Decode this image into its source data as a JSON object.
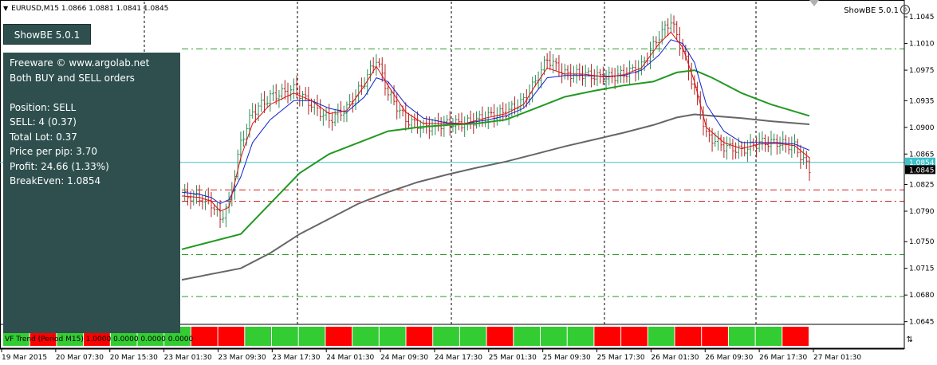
{
  "symbol_title": "EURUSD,M15  1.0866 1.0881 1.0841 1.0845",
  "indicator_name": "ShowBE 5.0.1",
  "button_label": "ShowBE 5.0.1",
  "info_panel": {
    "lines": [
      "Freeware © www.argolab.net",
      "Both BUY and SELL orders",
      "",
      "Position: SELL",
      "SELL: 4 (0.37)",
      "Total Lot: 0.37",
      "Price per pip: 3.70",
      "Profit: 24.66 (1.33%)",
      "BreakEven: 1.0854"
    ]
  },
  "subwindow_label": "VF Trend (Period M15) 1.0000 0.0000 0.0000 0.0000",
  "price_axis_labels": [
    "1.1045",
    "1.1010",
    "1.0975",
    "1.0935",
    "1.0900",
    "1.0865",
    "1.0825",
    "1.0790",
    "1.0750",
    "1.0715",
    "1.0680",
    "1.0645"
  ],
  "breakeven_price_label": "1.0854",
  "current_price_label": "1.0845",
  "time_axis_labels": [
    "19 Mar 2015",
    "20 Mar 07:30",
    "20 Mar 15:30",
    "23 Mar 01:30",
    "23 Mar 09:30",
    "23 Mar 17:30",
    "24 Mar 01:30",
    "24 Mar 09:30",
    "24 Mar 17:30",
    "25 Mar 01:30",
    "25 Mar 09:30",
    "25 Mar 17:30",
    "26 Mar 01:30",
    "26 Mar 09:30",
    "26 Mar 17:30",
    "27 Mar 01:30"
  ],
  "colors": {
    "bullish_bar": "#2e8b57",
    "bearish_bar": "#b22222",
    "fast_ma": "#e01010",
    "mid_ma": "#1020d0",
    "slow_ma": "#229922",
    "long_ma": "#666666",
    "breakeven_line": "#40c0c8",
    "level_green": "#2a9a2a",
    "level_red": "#d02020",
    "panel_bg": "#2f4f4f"
  },
  "chart_data": {
    "type": "candlestick",
    "ylim": [
      1.063,
      1.1065
    ],
    "breakeven": 1.0854,
    "last_price": 1.0845,
    "horizontal_levels_green": [
      1.1003,
      1.0733,
      1.0678
    ],
    "horizontal_levels_red": [
      1.0803,
      1.0818
    ],
    "close_path": [
      [
        0,
        1.081
      ],
      [
        6,
        1.0808
      ],
      [
        10,
        1.08
      ],
      [
        13,
        1.078
      ],
      [
        16,
        1.08
      ],
      [
        20,
        1.088
      ],
      [
        24,
        1.092
      ],
      [
        30,
        1.094
      ],
      [
        38,
        1.095
      ],
      [
        44,
        1.093
      ],
      [
        50,
        1.091
      ],
      [
        56,
        1.0925
      ],
      [
        62,
        1.096
      ],
      [
        66,
        1.099
      ],
      [
        70,
        1.0945
      ],
      [
        76,
        1.091
      ],
      [
        82,
        1.09
      ],
      [
        90,
        1.0905
      ],
      [
        96,
        1.0905
      ],
      [
        104,
        1.0915
      ],
      [
        110,
        1.092
      ],
      [
        116,
        1.0935
      ],
      [
        120,
        1.096
      ],
      [
        124,
        1.099
      ],
      [
        130,
        1.097
      ],
      [
        136,
        1.097
      ],
      [
        144,
        1.0965
      ],
      [
        150,
        1.097
      ],
      [
        156,
        1.098
      ],
      [
        162,
        1.102
      ],
      [
        166,
        1.104
      ],
      [
        170,
        1.1
      ],
      [
        174,
        1.095
      ],
      [
        178,
        1.089
      ],
      [
        184,
        1.0875
      ],
      [
        190,
        1.087
      ],
      [
        196,
        1.088
      ],
      [
        202,
        1.088
      ],
      [
        208,
        1.0875
      ],
      [
        213,
        1.0845
      ]
    ],
    "ma_fast": [
      [
        0,
        1.081
      ],
      [
        6,
        1.0808
      ],
      [
        10,
        1.0803
      ],
      [
        13,
        1.079
      ],
      [
        16,
        1.0795
      ],
      [
        20,
        1.086
      ],
      [
        24,
        1.0905
      ],
      [
        30,
        1.093
      ],
      [
        38,
        1.0945
      ],
      [
        44,
        1.0935
      ],
      [
        50,
        1.0918
      ],
      [
        56,
        1.0922
      ],
      [
        62,
        1.0955
      ],
      [
        66,
        1.098
      ],
      [
        70,
        1.0955
      ],
      [
        76,
        1.092
      ],
      [
        82,
        1.0905
      ],
      [
        90,
        1.0905
      ],
      [
        96,
        1.0905
      ],
      [
        104,
        1.0913
      ],
      [
        110,
        1.0918
      ],
      [
        116,
        1.093
      ],
      [
        120,
        1.0955
      ],
      [
        124,
        1.0978
      ],
      [
        130,
        1.097
      ],
      [
        136,
        1.097
      ],
      [
        144,
        1.0966
      ],
      [
        150,
        1.0969
      ],
      [
        156,
        1.0978
      ],
      [
        162,
        1.101
      ],
      [
        166,
        1.1025
      ],
      [
        170,
        1.1005
      ],
      [
        174,
        1.096
      ],
      [
        178,
        1.09
      ],
      [
        184,
        1.088
      ],
      [
        190,
        1.0872
      ],
      [
        196,
        1.0878
      ],
      [
        202,
        1.0879
      ],
      [
        208,
        1.0876
      ],
      [
        213,
        1.086
      ]
    ],
    "ma_mid": [
      [
        0,
        1.0815
      ],
      [
        6,
        1.0812
      ],
      [
        10,
        1.0808
      ],
      [
        13,
        1.08
      ],
      [
        16,
        1.0805
      ],
      [
        20,
        1.0835
      ],
      [
        24,
        1.088
      ],
      [
        30,
        1.091
      ],
      [
        38,
        1.0935
      ],
      [
        44,
        1.0935
      ],
      [
        50,
        1.0925
      ],
      [
        56,
        1.092
      ],
      [
        62,
        1.094
      ],
      [
        66,
        1.0965
      ],
      [
        70,
        1.096
      ],
      [
        76,
        1.093
      ],
      [
        82,
        1.0912
      ],
      [
        90,
        1.0906
      ],
      [
        96,
        1.0905
      ],
      [
        104,
        1.091
      ],
      [
        110,
        1.0915
      ],
      [
        116,
        1.0925
      ],
      [
        120,
        1.0945
      ],
      [
        124,
        1.0965
      ],
      [
        130,
        1.0968
      ],
      [
        136,
        1.0968
      ],
      [
        144,
        1.0967
      ],
      [
        150,
        1.0968
      ],
      [
        156,
        1.0975
      ],
      [
        162,
        1.0995
      ],
      [
        166,
        1.1015
      ],
      [
        170,
        1.101
      ],
      [
        174,
        1.0985
      ],
      [
        178,
        1.093
      ],
      [
        184,
        1.0895
      ],
      [
        190,
        1.088
      ],
      [
        196,
        1.088
      ],
      [
        202,
        1.088
      ],
      [
        208,
        1.0878
      ],
      [
        213,
        1.087
      ]
    ],
    "ma_slow": [
      [
        0,
        1.074
      ],
      [
        20,
        1.076
      ],
      [
        30,
        1.08
      ],
      [
        40,
        1.084
      ],
      [
        50,
        1.0865
      ],
      [
        60,
        1.088
      ],
      [
        70,
        1.0895
      ],
      [
        80,
        1.09
      ],
      [
        90,
        1.0903
      ],
      [
        100,
        1.0905
      ],
      [
        110,
        1.091
      ],
      [
        120,
        1.0925
      ],
      [
        130,
        1.094
      ],
      [
        140,
        1.0948
      ],
      [
        150,
        1.0955
      ],
      [
        160,
        1.096
      ],
      [
        168,
        1.0972
      ],
      [
        174,
        1.0975
      ],
      [
        180,
        1.0965
      ],
      [
        190,
        1.0945
      ],
      [
        200,
        1.093
      ],
      [
        213,
        1.0915
      ]
    ],
    "ma_long": [
      [
        0,
        1.07
      ],
      [
        20,
        1.0715
      ],
      [
        30,
        1.0735
      ],
      [
        40,
        1.076
      ],
      [
        50,
        1.078
      ],
      [
        60,
        1.08
      ],
      [
        70,
        1.0815
      ],
      [
        80,
        1.0828
      ],
      [
        90,
        1.0838
      ],
      [
        100,
        1.0847
      ],
      [
        110,
        1.0855
      ],
      [
        120,
        1.0865
      ],
      [
        130,
        1.0875
      ],
      [
        140,
        1.0884
      ],
      [
        150,
        1.0893
      ],
      [
        160,
        1.0903
      ],
      [
        168,
        1.0913
      ],
      [
        174,
        1.0917
      ],
      [
        180,
        1.0915
      ],
      [
        190,
        1.0912
      ],
      [
        200,
        1.0908
      ],
      [
        213,
        1.0904
      ]
    ],
    "trend_segments": [
      "up",
      "down",
      "up",
      "down",
      "up",
      "up",
      "up",
      "down",
      "down",
      "up",
      "up",
      "up",
      "down",
      "up",
      "up",
      "down",
      "up",
      "up",
      "down",
      "up",
      "up",
      "up",
      "down",
      "down",
      "up",
      "down",
      "down",
      "up",
      "up",
      "down"
    ]
  }
}
